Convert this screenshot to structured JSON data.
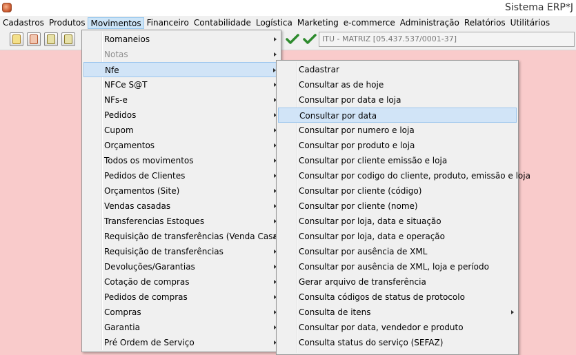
{
  "window": {
    "title": "Sistema ERP*J"
  },
  "menubar": [
    {
      "label": "Cadastros",
      "name": "menu-cadastros"
    },
    {
      "label": "Produtos",
      "name": "menu-produtos"
    },
    {
      "label": "Movimentos",
      "name": "menu-movimentos"
    },
    {
      "label": "Financeiro",
      "name": "menu-financeiro"
    },
    {
      "label": "Contabilidade",
      "name": "menu-contabilidade"
    },
    {
      "label": "Logística",
      "name": "menu-logistica"
    },
    {
      "label": "Marketing",
      "name": "menu-marketing"
    },
    {
      "label": "e-commerce",
      "name": "menu-e-commerce"
    },
    {
      "label": "Administração",
      "name": "menu-administracao"
    },
    {
      "label": "Relatórios",
      "name": "menu-relatorios"
    },
    {
      "label": "Utilitários",
      "name": "menu-utilitarios"
    }
  ],
  "toolbar": {
    "store": "ITU - MATRIZ [05.437.537/0001-37]"
  },
  "movimentos_menu": [
    {
      "label": "Romaneios",
      "submenu": true
    },
    {
      "label": "Notas",
      "submenu": true,
      "disabled": true
    },
    {
      "label": "Nfe",
      "submenu": true,
      "highlighted": true
    },
    {
      "label": "NFCe S@T",
      "submenu": true
    },
    {
      "label": "NFs-e",
      "submenu": true
    },
    {
      "label": "Pedidos",
      "submenu": true
    },
    {
      "label": "Cupom",
      "submenu": true
    },
    {
      "label": "Orçamentos",
      "submenu": true
    },
    {
      "label": "Todos os movimentos",
      "submenu": true
    },
    {
      "label": "Pedidos de Clientes",
      "submenu": true
    },
    {
      "label": "Orçamentos (Site)",
      "submenu": true
    },
    {
      "label": "Vendas casadas",
      "submenu": true
    },
    {
      "label": "Transferencias Estoques",
      "submenu": true
    },
    {
      "label": "Requisição de transferências (Venda Casada)",
      "submenu": true
    },
    {
      "label": "Requisição de transferências",
      "submenu": true
    },
    {
      "label": "Devoluções/Garantias",
      "submenu": true
    },
    {
      "label": "Cotação de compras",
      "submenu": true
    },
    {
      "label": "Pedidos de compras",
      "submenu": true
    },
    {
      "label": "Compras",
      "submenu": true
    },
    {
      "label": "Garantia",
      "submenu": true
    },
    {
      "label": "Pré Ordem de Serviço",
      "submenu": true
    }
  ],
  "nfe_submenu": [
    {
      "label": "Cadastrar"
    },
    {
      "label": "Consultar as de hoje"
    },
    {
      "label": "Consultar por data e loja"
    },
    {
      "label": "Consultar por data",
      "highlighted": true
    },
    {
      "label": "Consultar por numero e loja"
    },
    {
      "label": "Consultar por produto e loja"
    },
    {
      "label": "Consultar por cliente emissão e loja"
    },
    {
      "label": "Consultar por codigo do cliente, produto, emissão e loja"
    },
    {
      "label": "Consultar por cliente (código)"
    },
    {
      "label": "Consultar por cliente (nome)"
    },
    {
      "label": "Consultar por loja, data e situação"
    },
    {
      "label": "Consultar por loja, data e operação"
    },
    {
      "label": "Consultar por ausência de XML"
    },
    {
      "label": "Consultar por ausência de XML, loja e período"
    },
    {
      "label": "Gerar arquivo de transferência"
    },
    {
      "label": "Consulta códigos de status de protocolo"
    },
    {
      "label": "Consulta de itens",
      "submenu": true
    },
    {
      "label": "Consultar por data, vendedor e produto"
    },
    {
      "label": "Consulta status do serviço (SEFAZ)"
    }
  ],
  "colors": {
    "desktop": "#f9cbcb",
    "menu_highlight": "#d1e4f7",
    "check_green": "#2e8b2e"
  }
}
